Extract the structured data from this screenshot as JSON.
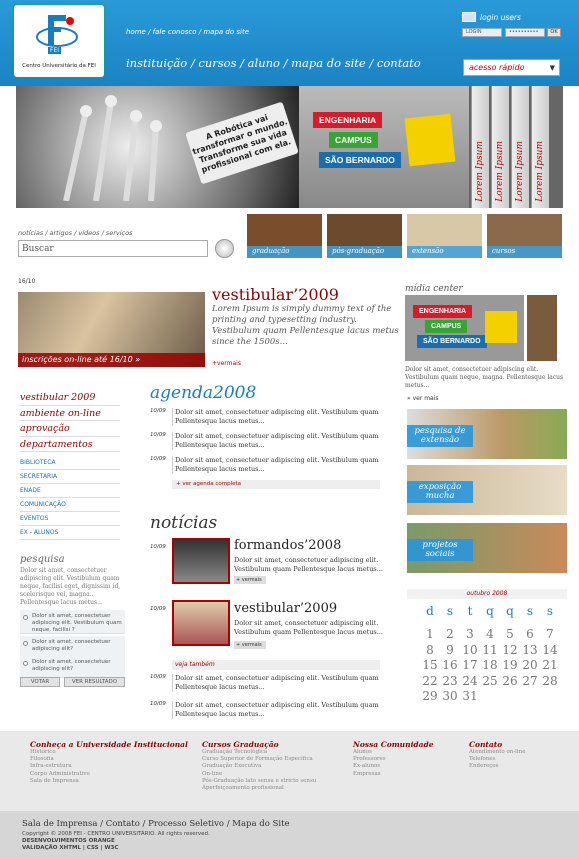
{
  "header": {
    "logo_mark": "FEI",
    "logo_text": "Centro Universitário da FEI",
    "top_links": [
      "home",
      "fale conosco",
      "mapa do site"
    ],
    "login_label": "login users",
    "login_placeholder": "LOGIN",
    "password_value": "••••••••••",
    "ok_label": "OK",
    "nav": [
      "instituição",
      "cursos",
      "aluno",
      "mapa do site",
      "contato"
    ],
    "quick_access": "acesso rápido"
  },
  "hero": {
    "robot_text": "A Robótica vai transformar o mundo. Transforme sua vida profissional com ela.",
    "signs": [
      "ENGENHARIA",
      "CAMPUS",
      "SÃO BERNARDO"
    ],
    "books": [
      "Lorem Ipsum",
      "Lorem Ipsum",
      "Lorem Ipsum",
      "Lorem Ipsum"
    ]
  },
  "search": {
    "tabs": [
      "notícias",
      "artigos",
      "vídeos",
      "serviços"
    ],
    "placeholder": "Buscar"
  },
  "quick_tiles": [
    "graduação",
    "pós-graduação",
    "extensão",
    "cursos"
  ],
  "featured": {
    "date": "16/10",
    "title": "vestibular’2009",
    "text": "Lorem Ipsum is simply dummy text of the printing and typesetting industry. Vestibulum quam Pellentesque lacus metus since the 1500s...",
    "image_label": "inscrições on-line até 16/10  »",
    "more": "+vermais"
  },
  "midia": {
    "title": "mídia center",
    "text": "Dolor sit amet, consectetuer adipiscing elit. Vestibulum quam neque, magna. Pellentesque lacus metus...",
    "more": "» ver mais"
  },
  "side_buttons": [
    "pesquisa de extensão",
    "exposição mucha",
    "projetos sociais"
  ],
  "left_nav": {
    "main": [
      "vestibular 2009",
      "ambiente on-line",
      "aprovação",
      "departamentos"
    ],
    "sub": [
      "BIBLIOTECA",
      "SECRETARIA",
      "ENADE",
      "COMUNICAÇÃO",
      "EVENTOS",
      "EX - ALUNOS"
    ]
  },
  "pesquisa": {
    "title": "pesquisa",
    "text": "Dolor sit amet, consectetuer adipiscing elit. Vestibulum quam neque, facilisi eget, dignissim id, scelerisque vel, magna.. Pellentesque lacus metus...",
    "options": [
      "Dolor sit amet, consectetuer adipiscing elit. Vestibulum quam neque, facilisi ?",
      "Dolor sit amet, consectetuer adipiscing elit?",
      "Dolor sit amet, consectetuer adipiscing elit?"
    ],
    "vote": "VOTAR",
    "results": "VER RESULTADO"
  },
  "agenda": {
    "title": "agenda2008",
    "items": [
      {
        "date": "10/09",
        "text": "Dolor sit amet, consectetuer adipiscing elit. Vestibulum quam Pellentesque lacus metus..."
      },
      {
        "date": "10/09",
        "text": "Dolor sit amet, consectetuer adipiscing elit. Vestibulum quam Pellentesque lacus metus..."
      },
      {
        "date": "10/09",
        "text": "Dolor sit amet, consectetuer adipiscing elit. Vestibulum quam Pellentesque lacus metus..."
      }
    ],
    "more": "+ ver agenda completa"
  },
  "noticias": {
    "title": "notícias",
    "items": [
      {
        "date": "10/09",
        "title": "formandos’2008",
        "text": "Dolor sit amet, consectetuer adipiscing elit. Vestibulum quam Pellentesque lacus metus...",
        "more": "+ vermais"
      },
      {
        "date": "10/09",
        "title": "vestibular’2009",
        "text": "Dolor sit amet, consectetuer adipiscing elit. Vestibulum quam Pellentesque lacus metus...",
        "more": "+ vermais"
      }
    ],
    "see_also": "veja também",
    "extra": [
      {
        "date": "10/09",
        "text": "Dolor sit amet, consectetuer adipiscing elit. Vestibulum quam Pellentesque lacus metus..."
      },
      {
        "date": "10/09",
        "text": "Dolor sit amet, consectetuer adipiscing elit. Vestibulum quam Pellentesque lacus metus..."
      }
    ]
  },
  "calendar": {
    "month": "outubro 2008",
    "days": [
      "d",
      "s",
      "t",
      "q",
      "q",
      "s",
      "s"
    ],
    "rows": [
      [
        "1",
        "2",
        "3",
        "4",
        "5",
        "6",
        "7"
      ],
      [
        "8",
        "9",
        "10",
        "11",
        "12",
        "13",
        "14"
      ],
      [
        "15",
        "16",
        "17",
        "18",
        "19",
        "20",
        "21"
      ],
      [
        "22",
        "23",
        "24",
        "25",
        "26",
        "27",
        "28"
      ],
      [
        "29",
        "30",
        "31",
        "",
        "",
        "",
        ""
      ]
    ]
  },
  "footer": {
    "cols": [
      {
        "h": "Conheça a Universidade Institucional",
        "l": [
          "Histórico",
          "Filosofia",
          "Infra-estrutura",
          "Corpo Administrativo",
          "Sala de Imprensa"
        ]
      },
      {
        "h": "Cursos Graduação",
        "l": [
          "Graduação Tecnológica",
          "Curso Superior de Formação Específica",
          "Graduação Executiva",
          "On-line",
          "Pós-Graduação lato sensu e stricto sensu",
          "Aperfeiçoamento profissional"
        ]
      },
      {
        "h": "Nossa Comunidade",
        "l": [
          "Alunos",
          "Professores",
          "Ex-alunos",
          "Empresas"
        ]
      },
      {
        "h": "Contato",
        "l": [
          "Atendimento on-line",
          "Telefones",
          "Endereços"
        ]
      }
    ],
    "links": [
      "Sala de Imprensa",
      "Contato",
      "Processo Seletivo",
      "Mapa do Site"
    ],
    "copy": "Copyright © 2008 FEI - CENTRO UNIVERSITÁRIO. All rights reserved.",
    "dev": "DESENVOLVIMENTOS ORANGE",
    "valid": "VALIDAÇÃO XHTML  |  CSS  |  W3C"
  }
}
